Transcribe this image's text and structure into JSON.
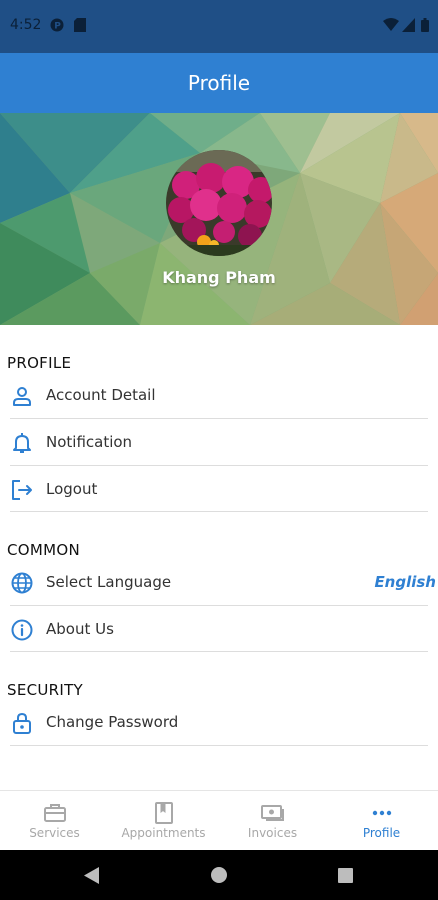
{
  "status_bar": {
    "time": "4:52"
  },
  "app_bar": {
    "title": "Profile"
  },
  "user": {
    "name": "Khang Pham"
  },
  "sections": {
    "profile": {
      "title": "PROFILE",
      "items": [
        {
          "label": "Account Detail",
          "icon": "person-icon"
        },
        {
          "label": "Notification",
          "icon": "bell-icon"
        },
        {
          "label": "Logout",
          "icon": "logout-icon"
        }
      ]
    },
    "common": {
      "title": "COMMON",
      "items": [
        {
          "label": "Select Language",
          "icon": "globe-icon",
          "value": "English"
        },
        {
          "label": "About Us",
          "icon": "info-icon"
        }
      ]
    },
    "security": {
      "title": "SECURITY",
      "items": [
        {
          "label": "Change Password",
          "icon": "lock-icon"
        }
      ]
    }
  },
  "bottom_nav": {
    "items": [
      {
        "label": "Services",
        "icon": "briefcase-icon"
      },
      {
        "label": "Appointments",
        "icon": "book-icon"
      },
      {
        "label": "Invoices",
        "icon": "cash-icon"
      },
      {
        "label": "Profile",
        "icon": "more-icon"
      }
    ],
    "active": "Profile"
  },
  "colors": {
    "primary": "#2f80d2",
    "status_bar": "#1f4f86",
    "inactive": "#a8a8a8"
  }
}
